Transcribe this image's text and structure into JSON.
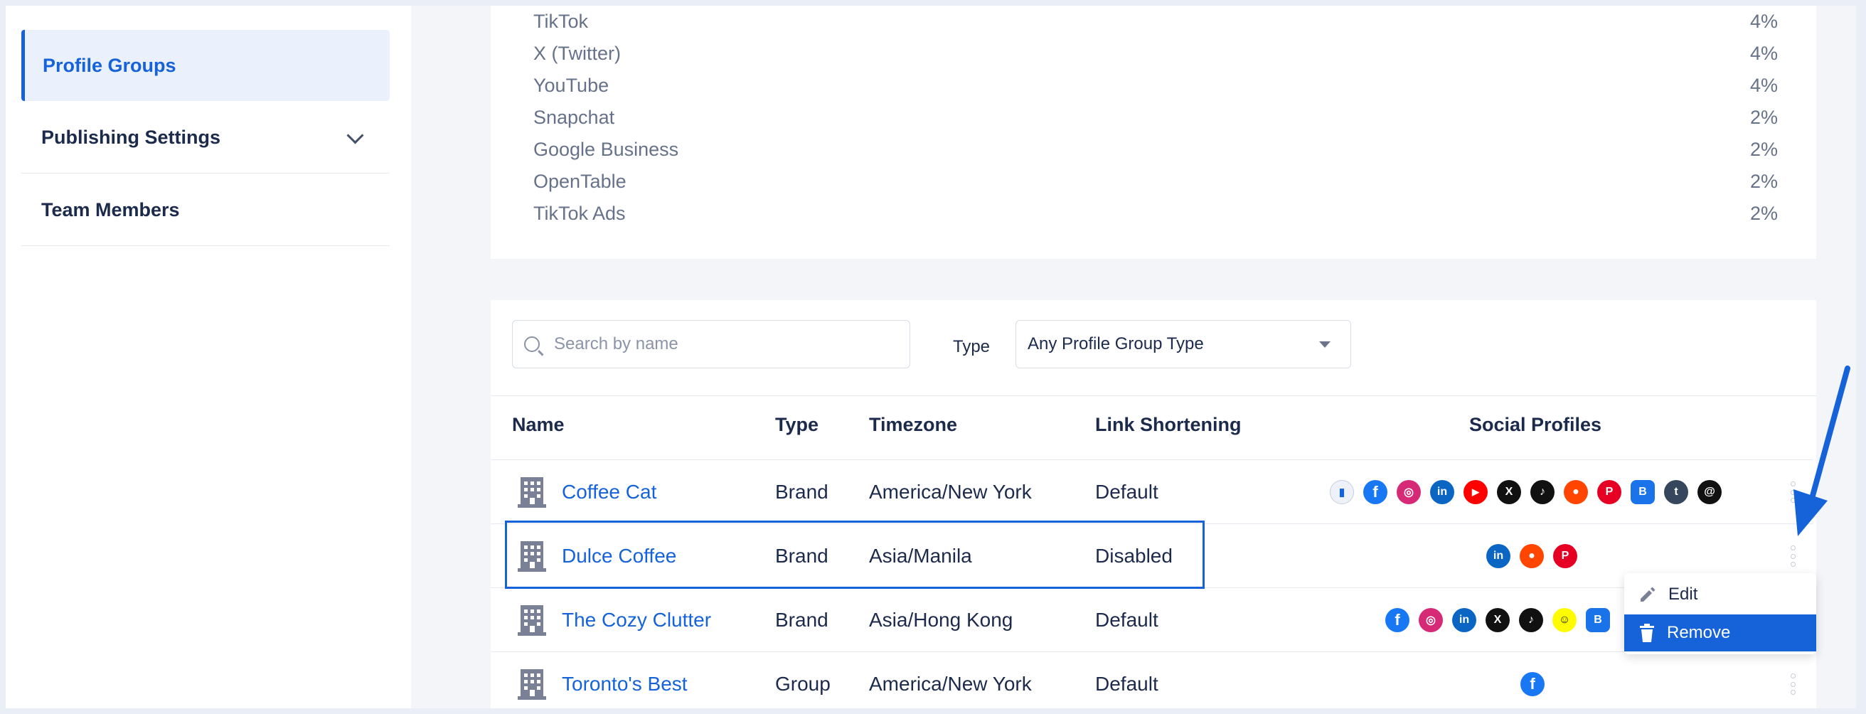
{
  "sidebar": {
    "items": [
      {
        "label": "Profile Groups"
      },
      {
        "label": "Publishing Settings"
      },
      {
        "label": "Team Members"
      }
    ]
  },
  "stats": [
    {
      "name": "TikTok",
      "pct": "4%"
    },
    {
      "name": "X (Twitter)",
      "pct": "4%"
    },
    {
      "name": "YouTube",
      "pct": "4%"
    },
    {
      "name": "Snapchat",
      "pct": "2%"
    },
    {
      "name": "Google Business",
      "pct": "2%"
    },
    {
      "name": "OpenTable",
      "pct": "2%"
    },
    {
      "name": "TikTok Ads",
      "pct": "2%"
    }
  ],
  "filters": {
    "search_placeholder": "Search by name",
    "type_label": "Type",
    "type_value": "Any Profile Group Type"
  },
  "table": {
    "headers": [
      "Name",
      "Type",
      "Timezone",
      "Link Shortening",
      "Social Profiles"
    ],
    "rows": [
      {
        "name": "Coffee Cat",
        "type": "Brand",
        "timezone": "America/New York",
        "link": "Default",
        "profiles": [
          "meta-business",
          "facebook",
          "instagram",
          "linkedin",
          "youtube",
          "x",
          "tiktok",
          "reddit",
          "pinterest",
          "google-business",
          "tumblr",
          "threads"
        ]
      },
      {
        "name": "Dulce Coffee",
        "type": "Brand",
        "timezone": "Asia/Manila",
        "link": "Disabled",
        "profiles": [
          "linkedin",
          "reddit",
          "pinterest"
        ]
      },
      {
        "name": "The Cozy Clutter",
        "type": "Brand",
        "timezone": "Asia/Hong Kong",
        "link": "Default",
        "profiles": [
          "facebook",
          "instagram",
          "linkedin",
          "x",
          "tiktok",
          "snapchat",
          "google-business"
        ]
      },
      {
        "name": "Toronto's Best",
        "type": "Group",
        "timezone": "America/New York",
        "link": "Default",
        "profiles": [
          "facebook"
        ]
      }
    ]
  },
  "menu": {
    "edit_label": "Edit",
    "remove_label": "Remove"
  },
  "colors": {
    "accent": "#1663d9",
    "facebook": "#1877f2",
    "instagram": "#d62976",
    "linkedin": "#0a66c2",
    "youtube": "#ff0000",
    "reddit": "#ff4500",
    "pinterest": "#e60023",
    "snapchat": "#fffc00",
    "black": "#111111"
  }
}
